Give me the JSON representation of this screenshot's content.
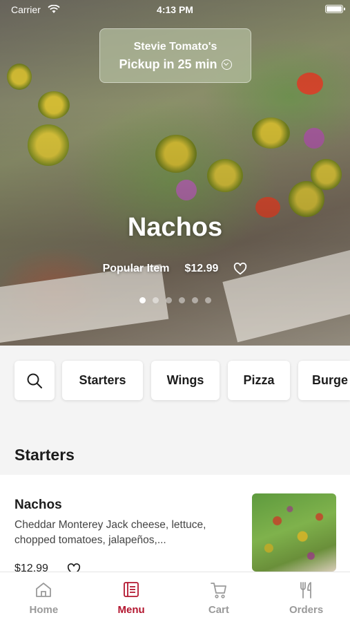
{
  "status_bar": {
    "carrier": "Carrier",
    "time": "4:13 PM"
  },
  "pickup": {
    "store": "Stevie Tomato's",
    "eta": "Pickup in 25 min"
  },
  "hero": {
    "title": "Nachos",
    "tag": "Popular Item",
    "price": "$12.99",
    "page_count": 6,
    "active_page": 1
  },
  "categories": [
    "Starters",
    "Wings",
    "Pizza",
    "Burge"
  ],
  "section": {
    "title": "Starters"
  },
  "item": {
    "name": "Nachos",
    "description": "Cheddar Monterey Jack cheese, lettuce, chopped tomatoes, jalapeños,...",
    "price": "$12.99"
  },
  "tabs": [
    {
      "label": "Home",
      "icon": "home-icon",
      "active": false
    },
    {
      "label": "Menu",
      "icon": "menu-icon",
      "active": true
    },
    {
      "label": "Cart",
      "icon": "cart-icon",
      "active": false
    },
    {
      "label": "Orders",
      "icon": "orders-icon",
      "active": false
    }
  ],
  "colors": {
    "accent": "#b3162f",
    "inactive_tab": "#9a9a9a",
    "background": "#f4f4f4"
  }
}
